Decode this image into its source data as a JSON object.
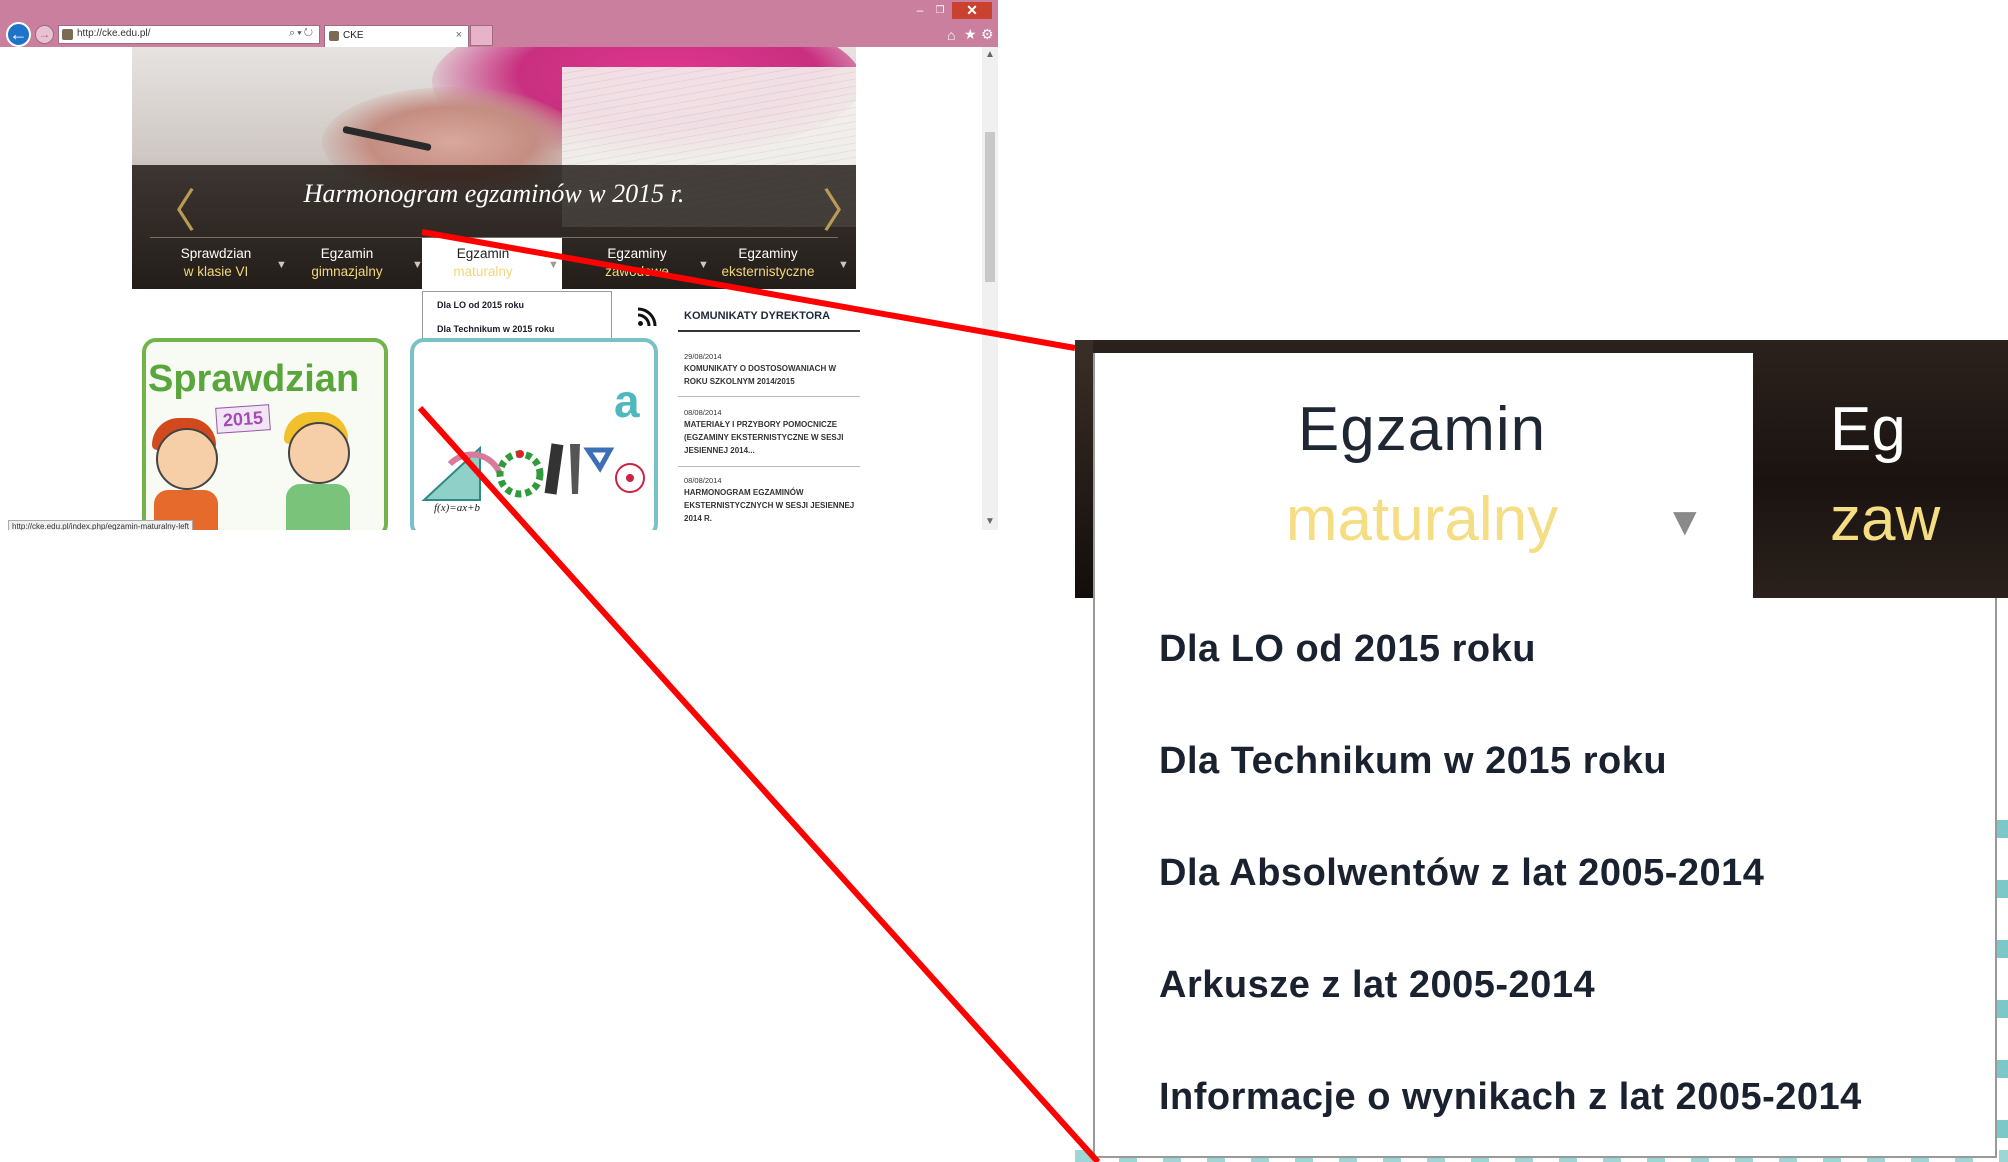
{
  "browser": {
    "url": "http://cke.edu.pl/",
    "tab_title": "CKE",
    "status_url": "http://cke.edu.pl/index.php/egzamin-maturalny-left"
  },
  "hero": {
    "caption": "Harmonogram egzaminów w 2015 r."
  },
  "nav": [
    {
      "line1": "Sprawdzian",
      "line2": "w klasie VI"
    },
    {
      "line1": "Egzamin",
      "line2": "gimnazjalny"
    },
    {
      "line1": "Egzamin",
      "line2": "maturalny"
    },
    {
      "line1": "Egzaminy",
      "line2": "zawodowe"
    },
    {
      "line1": "Egzaminy",
      "line2": "eksternistyczne"
    }
  ],
  "dropdown": [
    "Dla LO od 2015 roku",
    "Dla Technikum w 2015 roku",
    "Dla Absolwentów z lat 2005-2014",
    "Arkusze z lat 2005-2014",
    "Informacje o wynikach z lat 2005-2014"
  ],
  "news": {
    "title": "KOMUNIKATY DYREKTORA",
    "items": [
      {
        "date": "29/08/2014",
        "text": "KOMUNIKATY O DOSTOSOWANIACH W ROKU SZKOLNYM 2014/2015"
      },
      {
        "date": "08/08/2014",
        "text": "MATERIAŁY I PRZYBORY POMOCNICZE (EGZAMINY EKSTERNISTYCZNE W SESJI JESIENNEJ 2014..."
      },
      {
        "date": "08/08/2014",
        "text": "HARMONOGRAM EGZAMINÓW EKSTERNISTYCZNYCH W SESJI JESIENNEJ 2014 R."
      }
    ]
  },
  "cards": {
    "card1_title": "Sprawdzian",
    "card1_year": "2015",
    "card2_letter": "a",
    "card2_formula": "f(x)=ax+b"
  },
  "zoom": {
    "line1": "Egzamin",
    "line2": "maturalny",
    "next_line1": "Eg",
    "next_line2": "zaw"
  },
  "colors": {
    "accent_yellow": "#f2d77a",
    "callout_red": "#ff0000",
    "ie_chrome": "#c97f9d"
  }
}
